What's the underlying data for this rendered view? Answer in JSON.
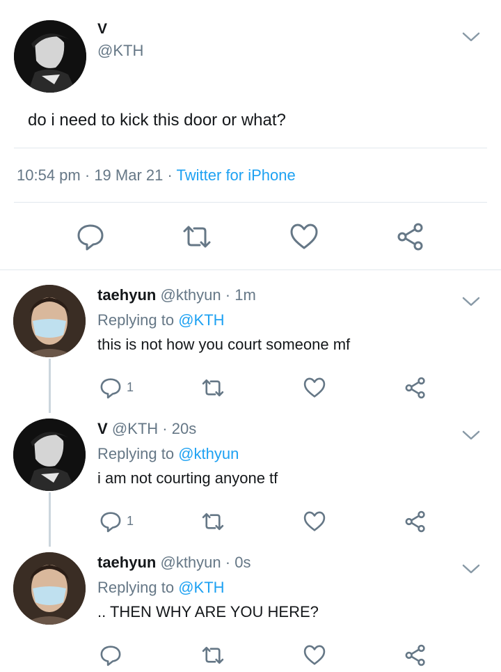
{
  "main_tweet": {
    "display_name": "V",
    "handle": "@KTH",
    "text": "do i need to kick this door or what?",
    "time": "10:54 pm",
    "date": "19 Mar 21",
    "separator": "·",
    "source": "Twitter for iPhone"
  },
  "replies": [
    {
      "display_name": "taehyun",
      "handle": "@kthyun",
      "time": "· 1m",
      "replying_prefix": "Replying to",
      "replying_to": "@KTH",
      "text": "this is not how you court someone mf",
      "reply_count": "1"
    },
    {
      "display_name": "V",
      "handle": "@KTH",
      "time": "· 20s",
      "replying_prefix": "Replying to",
      "replying_to": "@kthyun",
      "text": "i am not courting anyone tf",
      "reply_count": "1"
    },
    {
      "display_name": "taehyun",
      "handle": "@kthyun",
      "time": "· 0s",
      "replying_prefix": "Replying to",
      "replying_to": "@KTH",
      "text": ".. THEN WHY ARE YOU HERE?",
      "reply_count": ""
    }
  ],
  "colors": {
    "accent": "#1da1f2",
    "secondary_text": "#657786",
    "icon": "#657786",
    "divider": "#e1e8ed"
  },
  "icons": [
    "chevron-down-icon",
    "reply-icon",
    "retweet-icon",
    "like-icon",
    "share-icon"
  ]
}
